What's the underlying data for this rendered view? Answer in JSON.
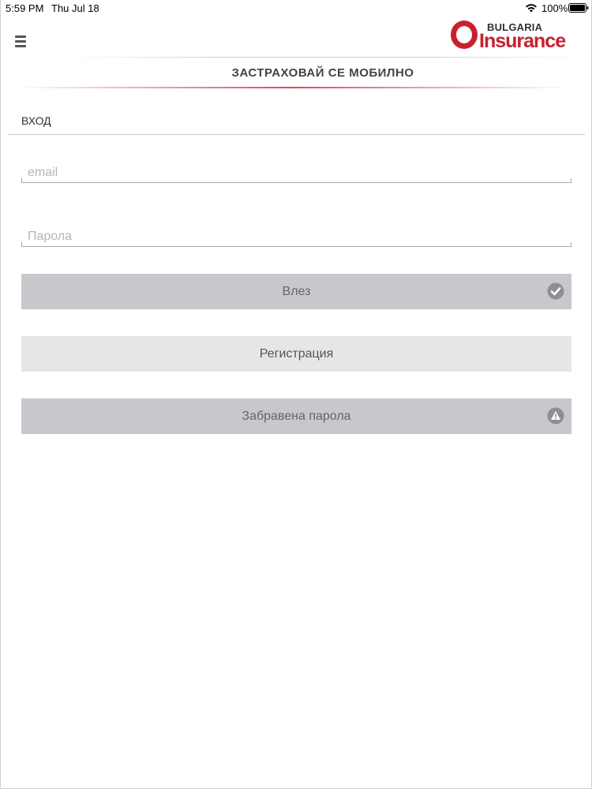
{
  "status_bar": {
    "time": "5:59 PM",
    "date": "Thu Jul 18",
    "battery": "100%"
  },
  "header": {
    "logo_top": "BULGARIA",
    "logo_main": "Insurance",
    "title": "ЗАСТРАХОВАЙ СЕ МОБИЛНО",
    "brand_color": "#c8202f"
  },
  "login": {
    "section_label": "ВХОД",
    "email_placeholder": "email",
    "password_placeholder": "Парола",
    "login_button": "Влез",
    "register_button": "Регистрация",
    "forgot_button": "Забравена парола"
  },
  "icons": {
    "menu": "hamburger-menu-icon",
    "login": "checkmark-circle-icon",
    "forgot": "warning-triangle-icon"
  }
}
